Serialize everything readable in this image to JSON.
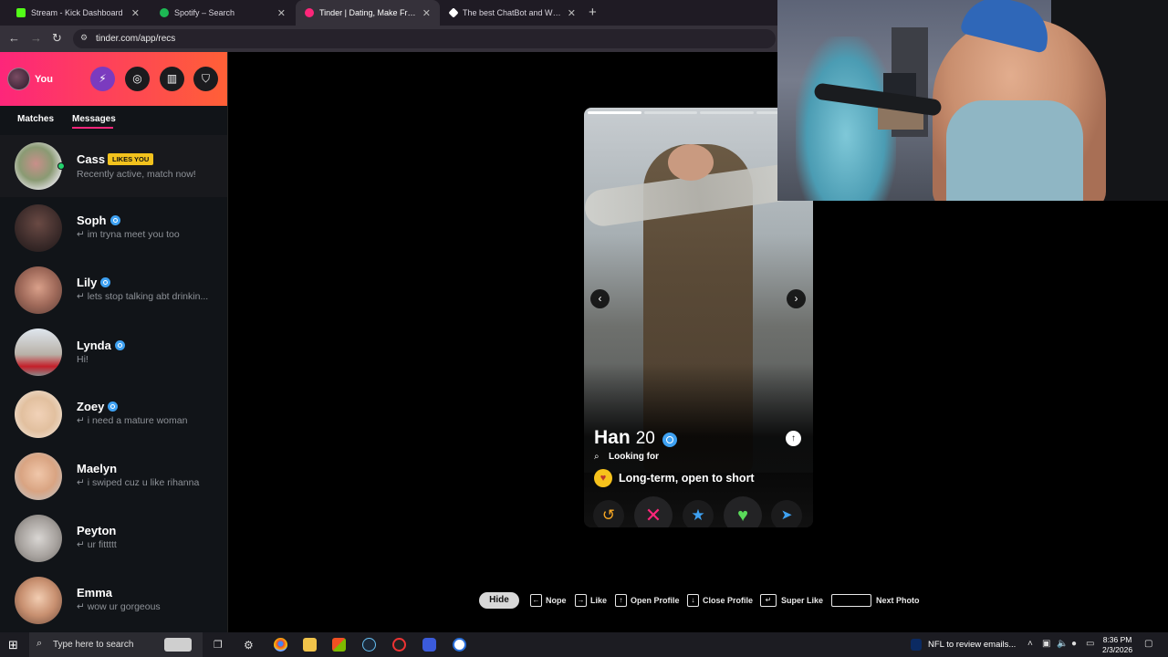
{
  "browser": {
    "tabs": [
      {
        "title": "Stream - Kick Dashboard",
        "favicon_color": "#53fc18"
      },
      {
        "title": "Spotify – Search",
        "favicon_color": "#1db954"
      },
      {
        "title": "Tinder | Dating, Make Friends &",
        "favicon_color": "#fd267a"
      },
      {
        "title": "The best ChatBot and Widgets",
        "favicon_color": "#ffffff"
      }
    ],
    "new_tab_label": "+",
    "url": "tinder.com/app/recs"
  },
  "sidebar": {
    "you_label": "You",
    "tabs": {
      "matches": "Matches",
      "messages": "Messages"
    },
    "likes_badge": "LIKES YOU",
    "conversations": [
      {
        "name": "Cass",
        "message": "Recently active, match now!",
        "verified": false
      },
      {
        "name": "Soph",
        "message": "↵ im tryna meet you too",
        "verified": true
      },
      {
        "name": "Lily",
        "message": "↵ lets stop talking abt drinkin...",
        "verified": true
      },
      {
        "name": "Lynda",
        "message": "Hi!",
        "verified": true
      },
      {
        "name": "Zoey",
        "message": "↵ i need a mature woman",
        "verified": true
      },
      {
        "name": "Maelyn",
        "message": "↵ i swiped cuz u like rihanna",
        "verified": false
      },
      {
        "name": "Peyton",
        "message": "↵ ur fittttt",
        "verified": false
      },
      {
        "name": "Emma",
        "message": "↵ wow ur gorgeous",
        "verified": false
      }
    ]
  },
  "card": {
    "name": "Han",
    "age": "20",
    "looking_for_label": "Looking for",
    "looking_for_value": "Long-term, open to short"
  },
  "hints": {
    "hide": "Hide",
    "nope": "Nope",
    "like": "Like",
    "open_profile": "Open Profile",
    "close_profile": "Close Profile",
    "super_like": "Super Like",
    "next_photo": "Next Photo"
  },
  "taskbar": {
    "search_placeholder": "Type here to search",
    "news": "NFL to review emails...",
    "time": "8:36 PM",
    "date": "2/3/2026"
  },
  "colors": {
    "brand_gradient_start": "#fd267a",
    "brand_gradient_end": "#ff6036",
    "verified": "#3ea1f2",
    "likes_badge": "#f2c21d"
  }
}
